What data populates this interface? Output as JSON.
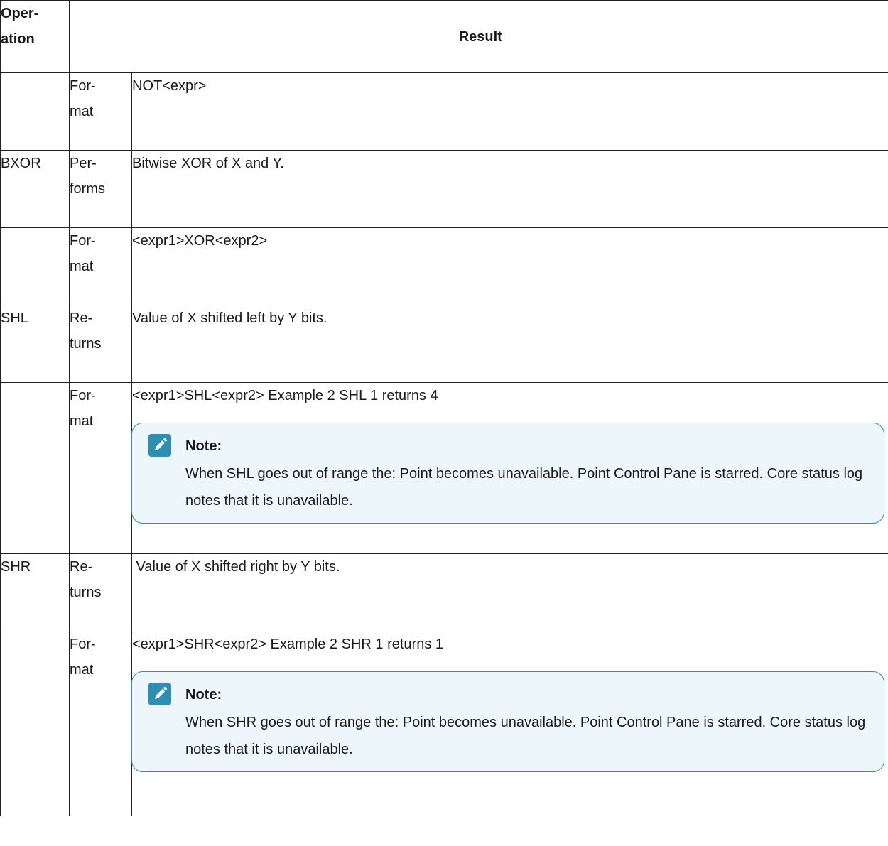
{
  "header": {
    "operation_line1": "Oper-",
    "operation_line2": "ation",
    "result": "Result"
  },
  "rows": [
    {
      "op": "",
      "sub1": "For-",
      "sub2": "mat",
      "result": "NOT<expr>"
    },
    {
      "op": "BXOR",
      "sub1": "Per-",
      "sub2": "forms",
      "result": "Bitwise XOR of X and Y."
    },
    {
      "op": "",
      "sub1": "For-",
      "sub2": "mat",
      "result": "<expr1>XOR<expr2>"
    },
    {
      "op": "SHL",
      "sub1": "Re-",
      "sub2": "turns",
      "result": "Value of X shifted left by Y bits."
    },
    {
      "op": "",
      "sub1": "For-",
      "sub2": "mat",
      "result": "<expr1>SHL<expr2> Example 2 SHL 1 returns  4",
      "note": {
        "icon": "pencil-note-icon",
        "title": "Note:",
        "body": "When SHL goes out of range the: Point becomes unavailable. Point Control Pane is starred. Core status log notes that it is unavailable."
      }
    },
    {
      "op": "SHR",
      "sub1": "Re-",
      "sub2": "turns",
      "result": " Value of X shifted right by Y bits."
    },
    {
      "op": "",
      "sub1": "For-",
      "sub2": "mat",
      "result": "<expr1>SHR<expr2> Example 2 SHR 1 returns 1",
      "note": {
        "icon": "pencil-note-icon",
        "title": "Note:",
        "body": "When SHR goes out of range the: Point becomes unavailable. Point Control Pane is starred. Core status log notes that it is unavailable."
      }
    }
  ],
  "colors": {
    "border": "#222222",
    "note_border": "#2a8fb3",
    "note_background": "#edf6fa",
    "icon": "#2a8fb3"
  }
}
